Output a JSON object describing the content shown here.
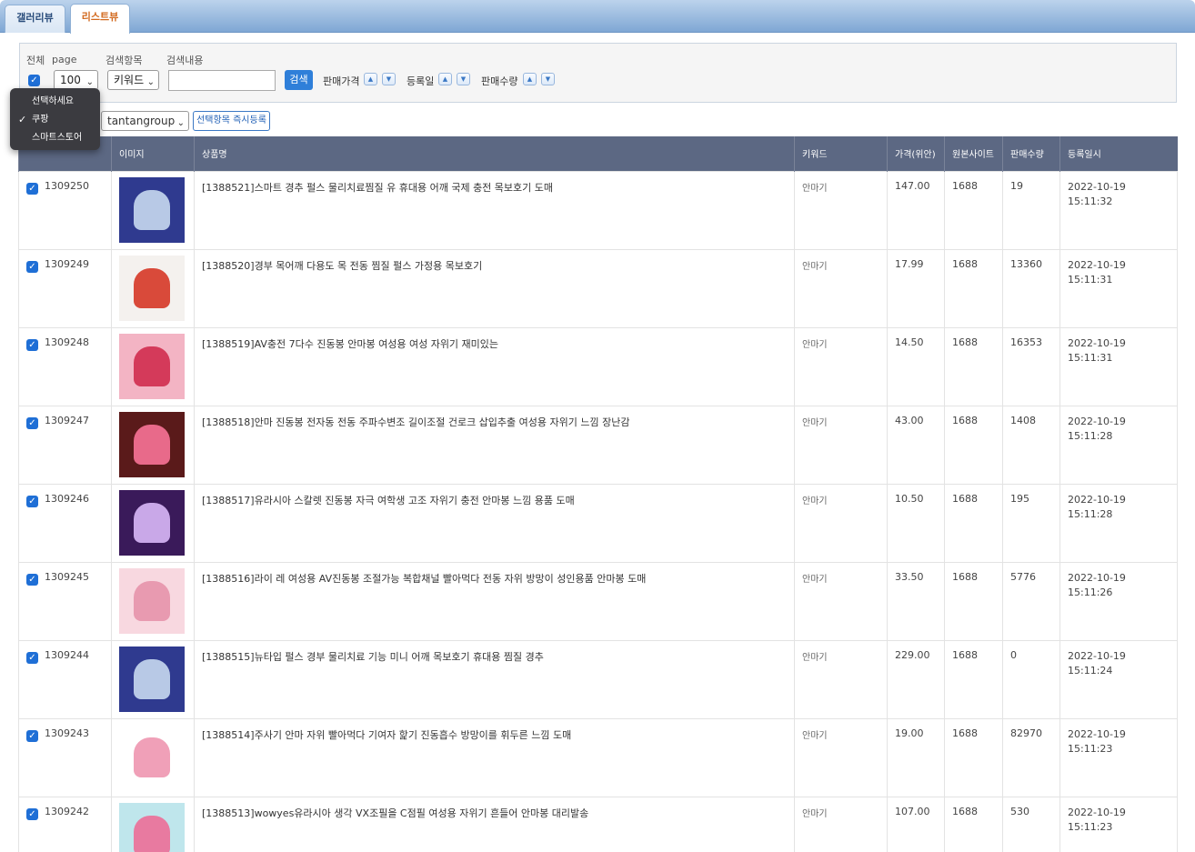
{
  "tabs": {
    "gallery": "갤러리뷰",
    "list": "리스트뷰"
  },
  "filter": {
    "all_label": "전체",
    "page_label": "page",
    "page_value": "100",
    "search_field_label": "검색항목",
    "search_field_value": "키워드",
    "search_content_label": "검색내용",
    "search_content_value": "",
    "search_button": "검색",
    "sort_price": "판매가격",
    "sort_date": "등록일",
    "sort_qty": "판매수량"
  },
  "toolbar": {
    "group_value": "tantangroup",
    "register_button": "선택항목 즉시등록"
  },
  "market_menu": {
    "items": [
      "선택하세요",
      "쿠팡",
      "스마트스토어"
    ],
    "checked_index": 1
  },
  "table": {
    "headers": [
      "",
      "이미지",
      "상품명",
      "키워드",
      "가격(위안)",
      "원본사이트",
      "판매수량",
      "등록일시"
    ],
    "rows": [
      {
        "id": "1309250",
        "name": "[1388521]스마트 경추 펄스 물리치료찜질 유 휴대용 어깨 국제 충전 목보호기 도매",
        "keyword": "안마기",
        "price": "147.00",
        "site": "1688",
        "qty": "19",
        "date": "2022-10-19",
        "time": "15:11:32",
        "thumb": [
          "#2f3a8f",
          "#b8c9e6"
        ]
      },
      {
        "id": "1309249",
        "name": "[1388520]경부 목어깨 다용도 목 전동 찜질 펄스 가정용 목보호기",
        "keyword": "안마기",
        "price": "17.99",
        "site": "1688",
        "qty": "13360",
        "date": "2022-10-19",
        "time": "15:11:31",
        "thumb": [
          "#f4f1ee",
          "#d94a3a"
        ]
      },
      {
        "id": "1309248",
        "name": "[1388519]AV충전 7다수 진동봉 안마봉 여성용 여성 자위기 재미있는",
        "keyword": "안마기",
        "price": "14.50",
        "site": "1688",
        "qty": "16353",
        "date": "2022-10-19",
        "time": "15:11:31",
        "thumb": [
          "#f3b4c4",
          "#d43a5a"
        ]
      },
      {
        "id": "1309247",
        "name": "[1388518]안마 진동봉 전자동 전동 주파수변조 길이조절 건로크 삽입추출 여성용 자위기 느낌 장난감",
        "keyword": "안마기",
        "price": "43.00",
        "site": "1688",
        "qty": "1408",
        "date": "2022-10-19",
        "time": "15:11:28",
        "thumb": [
          "#5a1a1a",
          "#e86a8a"
        ]
      },
      {
        "id": "1309246",
        "name": "[1388517]유라시아 스칼렛 진동봉 자극 여학생 고조 자위기 충전 안마봉 느낌 용품 도매",
        "keyword": "안마기",
        "price": "10.50",
        "site": "1688",
        "qty": "195",
        "date": "2022-10-19",
        "time": "15:11:28",
        "thumb": [
          "#3a1a5a",
          "#c9a8e8"
        ]
      },
      {
        "id": "1309245",
        "name": "[1388516]라이 레 여성용 AV진동봉 조절가능 복합채널 빨아먹다 전동 자위 방망이 성인용품 안마봉 도매",
        "keyword": "안마기",
        "price": "33.50",
        "site": "1688",
        "qty": "5776",
        "date": "2022-10-19",
        "time": "15:11:26",
        "thumb": [
          "#f8d8e0",
          "#e89ab0"
        ]
      },
      {
        "id": "1309244",
        "name": "[1388515]뉴타입 펄스 경부 물리치료 기능 미니 어깨 목보호기 휴대용 찜질 경추",
        "keyword": "안마기",
        "price": "229.00",
        "site": "1688",
        "qty": "0",
        "date": "2022-10-19",
        "time": "15:11:24",
        "thumb": [
          "#2f3a8f",
          "#b8c9e6"
        ]
      },
      {
        "id": "1309243",
        "name": "[1388514]주사기 안마 자위 빨아먹다 기여자 핥기 진동흡수 방망이를 휘두른 느낌 도매",
        "keyword": "안마기",
        "price": "19.00",
        "site": "1688",
        "qty": "82970",
        "date": "2022-10-19",
        "time": "15:11:23",
        "thumb": [
          "#ffffff",
          "#f0a0b8"
        ]
      },
      {
        "id": "1309242",
        "name": "[1388513]wowyes유라시아 생각 VX조필을 C점필 여성용 자위기 흔들어 안마봉 대리발송",
        "keyword": "안마기",
        "price": "107.00",
        "site": "1688",
        "qty": "530",
        "date": "2022-10-19",
        "time": "15:11:23",
        "thumb": [
          "#bfe6ec",
          "#e87aa0"
        ]
      }
    ]
  }
}
